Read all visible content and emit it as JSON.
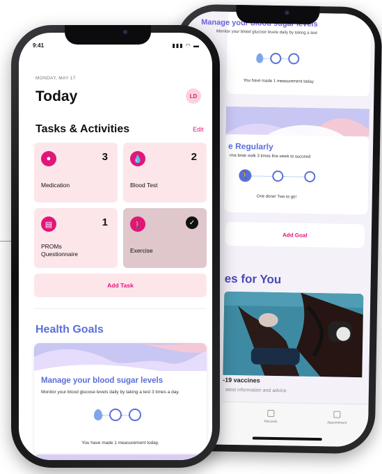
{
  "front": {
    "status": {
      "time": "9:41",
      "indicators": "▮▮▮ ◠ ▬"
    },
    "date": "MONDAY, MAY 17",
    "page_title": "Today",
    "avatar_initials": "LD",
    "tasks_section": {
      "title": "Tasks & Activities",
      "edit_label": "Edit",
      "tiles": [
        {
          "label": "Medication",
          "count": "3",
          "icon": "pills-icon"
        },
        {
          "label": "Blood Test",
          "count": "2",
          "icon": "blood-drop-icon"
        },
        {
          "label": "PROMs Questionnaire",
          "count": "1",
          "icon": "document-icon"
        },
        {
          "label": "Exercise",
          "count": "",
          "icon": "walking-icon",
          "completed": true
        }
      ],
      "add_task_label": "Add Task"
    },
    "health_goals": {
      "title": "Health Goals",
      "goal": {
        "title": "Manage your blood sugar levels",
        "description": "Monitor your blood glucose levels daily by taking a test 3 times a day.",
        "progress_text": "You have made 1 measurement today.",
        "completed": 1,
        "total": 3
      }
    }
  },
  "back": {
    "goal1": {
      "title": "Manage your blood sugar levels",
      "description": "Monitor your blood glucose levels daily by taking a test",
      "progress_text": "You have made 1 measurement today"
    },
    "goal2": {
      "title": "e Regularly",
      "description": "rms brisk walk 3 times this week to succeed",
      "progress_text": "One done! Two to go!"
    },
    "add_goal_label": "Add Goal",
    "resources_title": "es for You",
    "article": {
      "title": "-19 vaccines",
      "subtitle": "atest information and advice"
    },
    "tabs": [
      {
        "label": "Records",
        "icon": "records-icon"
      },
      {
        "label": "Appointment",
        "icon": "calendar-icon"
      }
    ]
  },
  "colors": {
    "accent_pink": "#e0167a",
    "goal_blue": "#5a6fd9",
    "tile_bg": "#fde6ea",
    "tile_done_bg": "#dfc7cb"
  }
}
